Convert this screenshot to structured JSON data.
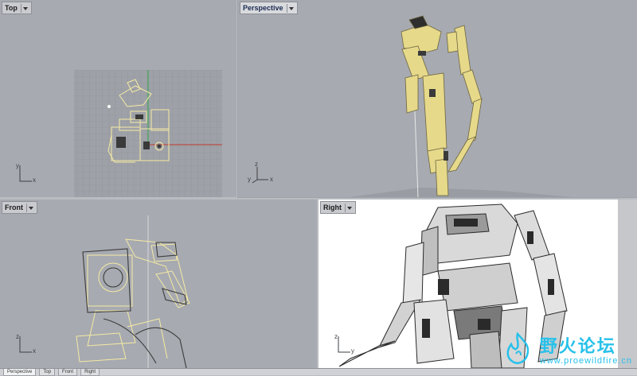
{
  "viewports": {
    "top": {
      "title": "Top"
    },
    "perspective": {
      "title": "Perspective",
      "active": true
    },
    "front": {
      "title": "Front"
    },
    "right": {
      "title": "Right"
    }
  },
  "axes": {
    "top": {
      "v": "y",
      "h": "x"
    },
    "perspective": {
      "v": "z",
      "h": "x",
      "extra": "y"
    },
    "front": {
      "v": "z",
      "h": "x"
    },
    "right": {
      "v": "z",
      "h": "y"
    }
  },
  "bottom_tabs": [
    "Perspective",
    "Top",
    "Front",
    "Right"
  ],
  "watermark": {
    "cn": "野火论坛",
    "url": "www.proewildfire.cn"
  },
  "colors": {
    "viewport_bg": "#a7aab0",
    "wire": "#f5eaa5",
    "wire_dark": "#3a3a3a",
    "axis_x": "#c0392b",
    "axis_y": "#2ea84a",
    "watermark": "#27c1ea"
  }
}
